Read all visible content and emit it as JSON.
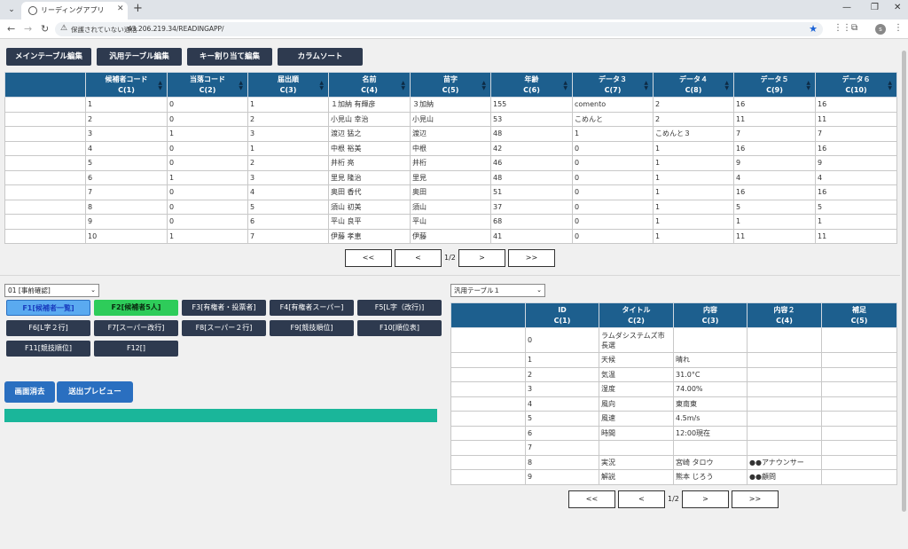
{
  "browser": {
    "tab_title": "リーディングアプリ",
    "security_warning": "保護されていない通信",
    "url": "43.206.219.34/READINGAPP/"
  },
  "toolbar": {
    "buttons": [
      "メインテーブル編集",
      "汎用テーブル編集",
      "キー割り当て編集",
      "カラムソート"
    ]
  },
  "main_table": {
    "headers": [
      [
        "",
        ""
      ],
      [
        "候補者コード",
        "C(1)"
      ],
      [
        "当落コード",
        "C(2)"
      ],
      [
        "届出順",
        "C(3)"
      ],
      [
        "名前",
        "C(4)"
      ],
      [
        "苗字",
        "C(5)"
      ],
      [
        "年齢",
        "C(6)"
      ],
      [
        "データ３",
        "C(7)"
      ],
      [
        "データ４",
        "C(8)"
      ],
      [
        "データ５",
        "C(9)"
      ],
      [
        "データ６",
        "C(10)"
      ]
    ],
    "rows": [
      [
        "",
        "1",
        "0",
        "1",
        "１加納 有輝彦",
        "３加納",
        "155",
        "comento",
        "2",
        "16",
        "16"
      ],
      [
        "",
        "2",
        "0",
        "2",
        "小見山 幸治",
        "小見山",
        "53",
        "こめんと",
        "2",
        "11",
        "11"
      ],
      [
        "",
        "3",
        "1",
        "3",
        "渡辺 猛之",
        "渡辺",
        "48",
        "1",
        "こめんと３",
        "7",
        "7"
      ],
      [
        "",
        "4",
        "0",
        "1",
        "中根 裕美",
        "中根",
        "42",
        "0",
        "1",
        "16",
        "16"
      ],
      [
        "",
        "5",
        "0",
        "2",
        "井桁 亮",
        "井桁",
        "46",
        "0",
        "1",
        "9",
        "9"
      ],
      [
        "",
        "6",
        "1",
        "3",
        "里見 隆治",
        "里見",
        "48",
        "0",
        "1",
        "4",
        "4"
      ],
      [
        "",
        "7",
        "0",
        "4",
        "奥田 香代",
        "奥田",
        "51",
        "0",
        "1",
        "16",
        "16"
      ],
      [
        "",
        "8",
        "0",
        "5",
        "須山 初美",
        "須山",
        "37",
        "0",
        "1",
        "5",
        "5"
      ],
      [
        "",
        "9",
        "0",
        "6",
        "平山 良平",
        "平山",
        "68",
        "0",
        "1",
        "1",
        "1"
      ],
      [
        "",
        "10",
        "1",
        "7",
        "伊藤 孝恵",
        "伊藤",
        "41",
        "0",
        "1",
        "11",
        "11"
      ]
    ],
    "pager": {
      "first": "<<",
      "prev": "<",
      "page": "1/2",
      "next": ">",
      "last": ">>"
    }
  },
  "left_panel": {
    "select_value": "01 [事前確認]",
    "fkeys": [
      "F1[候補者一覧]",
      "F2[候補者5人]",
      "F3[有権者・投票者]",
      "F4[有権者スーパー]",
      "F5[L字（改行)]",
      "F6[L字２行]",
      "F7[スーパー改行]",
      "F8[スーパー２行]",
      "F9[競技順位]",
      "F10[順位表]",
      "F11[競技順位]",
      "F12[]"
    ],
    "clear_button": "画面消去",
    "preview_button": "送出プレビュー"
  },
  "right_panel": {
    "select_value": "汎用テーブル１",
    "headers": [
      [
        "",
        ""
      ],
      [
        "ID",
        "C(1)"
      ],
      [
        "タイトル",
        "C(2)"
      ],
      [
        "内容",
        "C(3)"
      ],
      [
        "内容２",
        "C(4)"
      ],
      [
        "補足",
        "C(5)"
      ]
    ],
    "rows": [
      [
        "",
        "0",
        "ラムダシステムズ市長選",
        "",
        "",
        ""
      ],
      [
        "",
        "1",
        "天候",
        "晴れ",
        "",
        ""
      ],
      [
        "",
        "2",
        "気温",
        "31.0°C",
        "",
        ""
      ],
      [
        "",
        "3",
        "湿度",
        "74.00%",
        "",
        ""
      ],
      [
        "",
        "4",
        "風向",
        "東南東",
        "",
        ""
      ],
      [
        "",
        "5",
        "風速",
        "4.5m/s",
        "",
        ""
      ],
      [
        "",
        "6",
        "時間",
        "12:00現在",
        "",
        ""
      ],
      [
        "",
        "7",
        "",
        "",
        "",
        ""
      ],
      [
        "",
        "8",
        "実況",
        "宮崎 タロウ",
        "●●アナウンサー",
        ""
      ],
      [
        "",
        "9",
        "解説",
        "熊本 じろう",
        "●●顧問",
        ""
      ]
    ],
    "pager": {
      "first": "<<",
      "prev": "<",
      "page": "1/2",
      "next": ">",
      "last": ">>"
    }
  },
  "colors": {
    "header_blue": "#1d5f8e",
    "dark_button": "#2e3a4f",
    "f1_active": "#5aaaf0",
    "f2_active": "#2ecc5a",
    "progress_green": "#1ab69a"
  }
}
